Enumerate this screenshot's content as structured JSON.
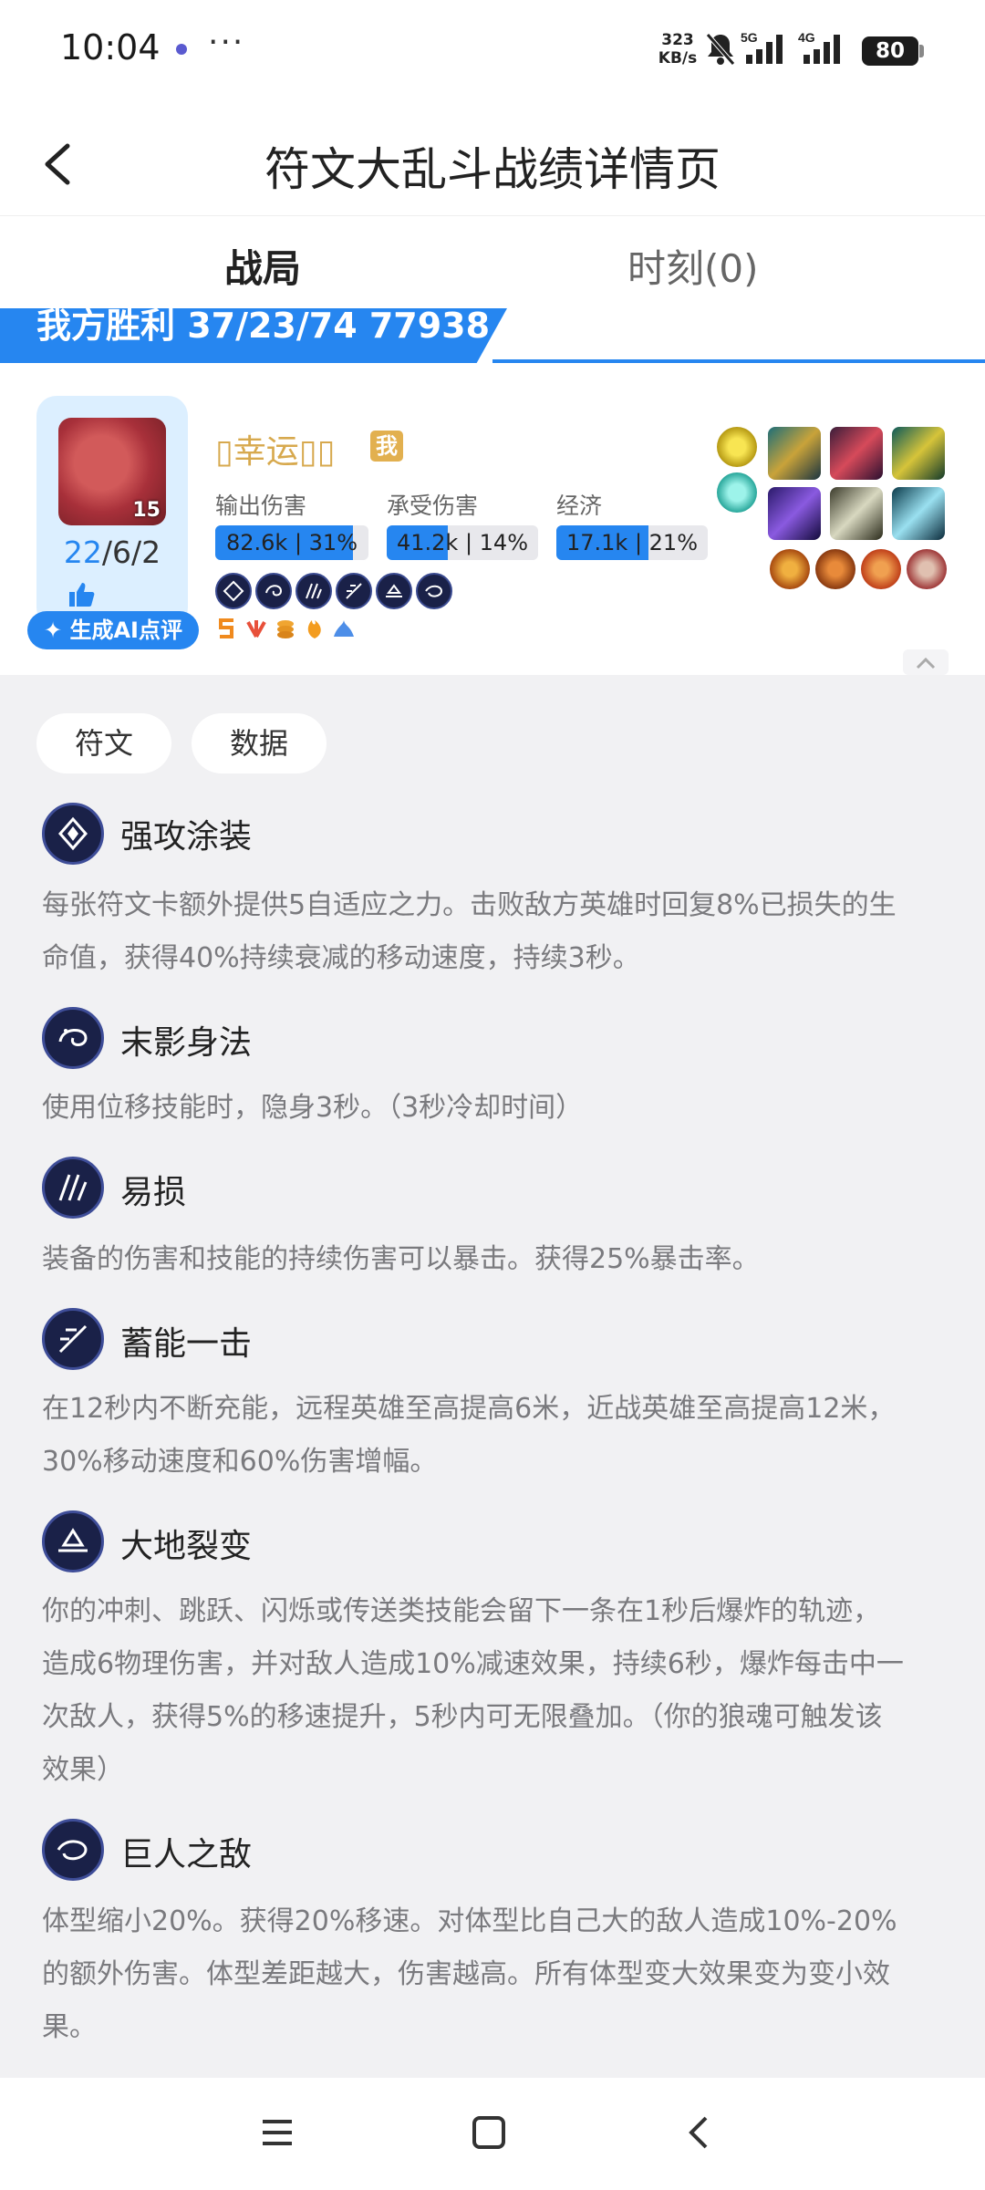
{
  "status": {
    "time": "10:04",
    "net_speed": "323",
    "net_unit": "KB/s",
    "net5g": "5G",
    "net4g": "4G",
    "battery": "80"
  },
  "header": {
    "title": "符文大乱斗战绩详情页"
  },
  "tabs": {
    "match": "战局",
    "moments": "时刻(0)"
  },
  "banner": {
    "text": "我方胜利 37/23/74 77938"
  },
  "player": {
    "name": "▯幸运▯▯",
    "me_badge": "我",
    "level": "15",
    "kda_k": "22",
    "kda_rest": "/6/2",
    "ai_button": "✦ 生成AI点评"
  },
  "stats": {
    "damage_label": "输出伤害",
    "damage_value": "82.6k | 31%",
    "damage_fraction": 0.31,
    "taken_label": "承受伤害",
    "taken_value": "41.2k | 14%",
    "taken_fraction": 0.14,
    "gold_label": "经济",
    "gold_value": "17.1k | 21%",
    "gold_fraction": 0.21
  },
  "segments": {
    "runes": "符文",
    "data": "数据"
  },
  "runes": [
    {
      "name": "强攻涂装",
      "icon": "card-icon",
      "desc_lines": [
        "每张符文卡额外提供5自适应之力。击败敌方英雄时回复8%已损失的生",
        "命值，获得40%持续衰减的移动速度，持续3秒。"
      ]
    },
    {
      "name": "末影身法",
      "icon": "swirl-icon",
      "desc_lines": [
        "使用位移技能时，隐身3秒。（3秒冷却时间）"
      ]
    },
    {
      "name": "易损",
      "icon": "claw-icon",
      "desc_lines": [
        "装备的伤害和技能的持续伤害可以暴击。获得25%暴击率。"
      ]
    },
    {
      "name": "蓄能一击",
      "icon": "dash-icon",
      "desc_lines": [
        "在12秒内不断充能，远程英雄至高提高6米，近战英雄至高提高12米，",
        "30%移动速度和60%伤害增幅。"
      ]
    },
    {
      "name": "大地裂变",
      "icon": "ground-icon",
      "desc_lines": [
        "你的冲刺、跳跃、闪烁或传送类技能会留下一条在1秒后爆炸的轨迹，",
        "造成6物理伤害，并对敌人造成10%减速效果，持续6秒，爆炸每击中一",
        "次敌人，获得5%的移速提升，5秒内可无限叠加。（你的狼魂可触发该",
        "效果）"
      ]
    },
    {
      "name": "巨人之敌",
      "icon": "giant-icon",
      "desc_lines": [
        "体型缩小20%。获得20%移速。对体型比自己大的敌人造成10%-20%",
        "的额外伤害。体型差距越大，伤害越高。所有体型变大效果变为变小效",
        "果。"
      ]
    }
  ]
}
